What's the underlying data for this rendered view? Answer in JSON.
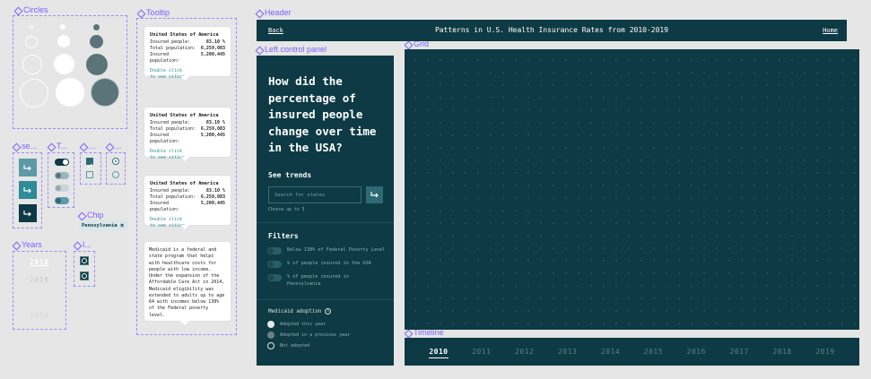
{
  "labels": {
    "circles": "Circles",
    "tooltip": "Tooltip",
    "header": "Header",
    "left_panel": "Left control panel",
    "grid": "Grid",
    "timeline": "Timeline",
    "buttons": "se...",
    "toggles": "T...",
    "checkboxes": "...",
    "radios": "...",
    "chip": "Chip",
    "years": "Years",
    "icons": "I..."
  },
  "colors": {
    "panel": "#0d3a44",
    "accent": "#2d6a74",
    "link": "#2f8f95",
    "frame_label": "#7b61ff"
  },
  "header": {
    "back": "Back",
    "title": "Patterns in U.S. Health Insurance Rates from 2010-2019",
    "home": "Home"
  },
  "left_panel": {
    "question": "How did the percentage of insured people change over time in the USA?",
    "see_trends": "See trends",
    "search_placeholder": "Search for states",
    "choose_hint": "Choose up to 3",
    "filters_title": "Filters",
    "filters": [
      "Below 138% of Federal Poverty Level",
      "% of people insured in the USA",
      "% of people insured in Pennsylvania"
    ],
    "medicaid_title": "Medicaid adoption",
    "medicaid_options": [
      "Adopted this year",
      "Adopted in a previous year",
      "Not adopted"
    ]
  },
  "tooltips": [
    {
      "title": "United States of America",
      "rows": [
        {
          "label": "Insured people:",
          "value": "83.10 %"
        },
        {
          "label": "Total population:",
          "value": "6,259,083"
        },
        {
          "label": "Insured population:",
          "value": "5,200,445"
        }
      ],
      "link": "Double click to see cities"
    },
    {
      "title": "United States of America",
      "rows": [
        {
          "label": "Insured people:",
          "value": "83.10 %"
        },
        {
          "label": "Total population:",
          "value": "6,259,083"
        },
        {
          "label": "Insured population:",
          "value": "5,200,445"
        }
      ],
      "link": "Double click to see cities"
    },
    {
      "title": "United States of America",
      "rows": [
        {
          "label": "Insured people:",
          "value": "83.10 %"
        },
        {
          "label": "Total population:",
          "value": "6,259,083"
        },
        {
          "label": "Insured population:",
          "value": "5,200,445"
        }
      ],
      "link": "Double click to see cities"
    }
  ],
  "medicaid_info": "Medicaid is a federal and state program that helps with healthcare costs for people with low income. Under the expansion of the Affordable Care Act in 2014, Medicaid eligibility was extended to adults up to age 64 with incomes below 138% of the Federal poverty level.",
  "chip": {
    "label": "Pennsylvania"
  },
  "year_samples": [
    "2010",
    "2010",
    "2010"
  ],
  "timeline": {
    "years": [
      "2010",
      "2011",
      "2012",
      "2013",
      "2014",
      "2015",
      "2016",
      "2017",
      "2018",
      "2019"
    ],
    "active": "2010"
  }
}
